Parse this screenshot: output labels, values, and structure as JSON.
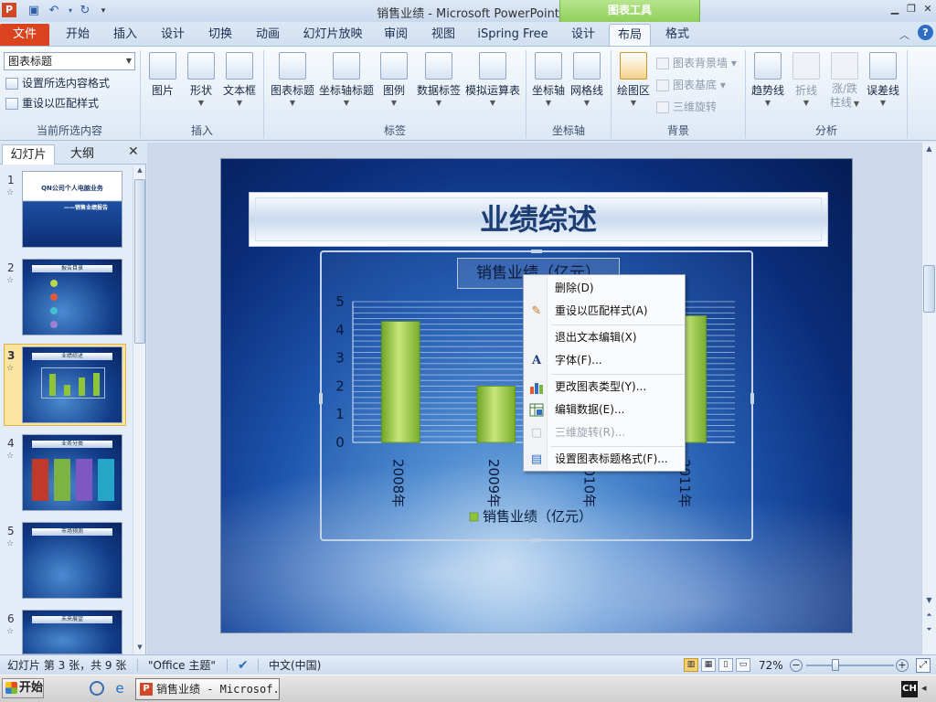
{
  "window": {
    "title": "销售业绩 - Microsoft PowerPoint",
    "contextual_group": "图表工具",
    "app_icon": "P"
  },
  "tabs": [
    "文件",
    "开始",
    "插入",
    "设计",
    "切换",
    "动画",
    "幻灯片放映",
    "审阅",
    "视图",
    "iSpring Free",
    "设计",
    "布局",
    "格式"
  ],
  "active_tab": "布局",
  "ribbon": {
    "current_selection": {
      "dropdown_value": "图表标题",
      "format_selection": "设置所选内容格式",
      "reset_style": "重设以匹配样式",
      "group_label": "当前所选内容"
    },
    "insert": {
      "picture": "图片",
      "shapes": "形状",
      "textbox": "文本框",
      "group_label": "插入"
    },
    "labels": {
      "chart_title": "图表标题",
      "axis_titles": "坐标轴标题",
      "legend": "图例",
      "data_labels": "数据标签",
      "data_table": "模拟运算表",
      "group_label": "标签"
    },
    "axes": {
      "axes": "坐标轴",
      "gridlines": "网格线",
      "group_label": "坐标轴"
    },
    "background": {
      "plot_area": "绘图区",
      "chart_wall": "图表背景墙",
      "chart_floor": "图表基底",
      "rotation_3d": "三维旋转",
      "group_label": "背景"
    },
    "analysis": {
      "trendline": "趋势线",
      "lines_1": "折线",
      "updown_1": "涨/跌",
      "updown_2": "柱线",
      "error_bars": "误差线",
      "group_label": "分析"
    }
  },
  "left_panel": {
    "tab_slides": "幻灯片",
    "tab_outline": "大纲",
    "slides": [
      {
        "num": "1",
        "title": "QN公司个人电脑业务",
        "subtitle": "——销售业绩报告"
      },
      {
        "num": "2",
        "title": "报告目录"
      },
      {
        "num": "3",
        "title": "业绩综述"
      },
      {
        "num": "4",
        "title": "业务分类"
      },
      {
        "num": "5",
        "title": "市场预测"
      },
      {
        "num": "6",
        "title": "未来展望"
      }
    ],
    "selected_slide": "3"
  },
  "slide": {
    "title": "业绩综述",
    "chart_title": "销售业绩（亿元）"
  },
  "chart_data": {
    "type": "bar",
    "title": "销售业绩（亿元）",
    "categories": [
      "2008年",
      "2009年",
      "2010年",
      "2011年"
    ],
    "series": [
      {
        "name": "销售业绩（亿元）",
        "values": [
          4.3,
          2.0,
          3.5,
          4.5
        ]
      }
    ],
    "ylim": [
      0,
      5
    ],
    "yticks": [
      "0",
      "1",
      "2",
      "3",
      "4",
      "5"
    ],
    "grid": true,
    "legend": "bottom",
    "bar_color": "#8fc43a"
  },
  "context_menu": {
    "items": [
      {
        "label": "删除(D)",
        "icon": "",
        "disabled": false
      },
      {
        "label": "重设以匹配样式(A)",
        "icon": "reset-style-icon",
        "disabled": false
      },
      {
        "label": "退出文本编辑(X)",
        "icon": "",
        "disabled": false
      },
      {
        "label": "字体(F)...",
        "icon": "font-icon",
        "disabled": false
      },
      {
        "label": "更改图表类型(Y)...",
        "icon": "chart-type-icon",
        "disabled": false
      },
      {
        "label": "编辑数据(E)...",
        "icon": "edit-data-icon",
        "disabled": false
      },
      {
        "label": "三维旋转(R)...",
        "icon": "rotation-icon",
        "disabled": true
      },
      {
        "label": "设置图表标题格式(F)...",
        "icon": "format-title-icon",
        "disabled": false
      }
    ]
  },
  "status_bar": {
    "slide_info": "幻灯片 第 3 张，共 9 张",
    "theme": "\"Office 主题\"",
    "language": "中文(中国)",
    "zoom": "72%"
  },
  "taskbar": {
    "start": "开始",
    "task_item": "销售业绩 - Microsof...",
    "ime": "CH"
  },
  "colors": {
    "file_tab": "#d9431e",
    "contextual_group": "#8fcf5b",
    "bar": "#8fc43a"
  }
}
